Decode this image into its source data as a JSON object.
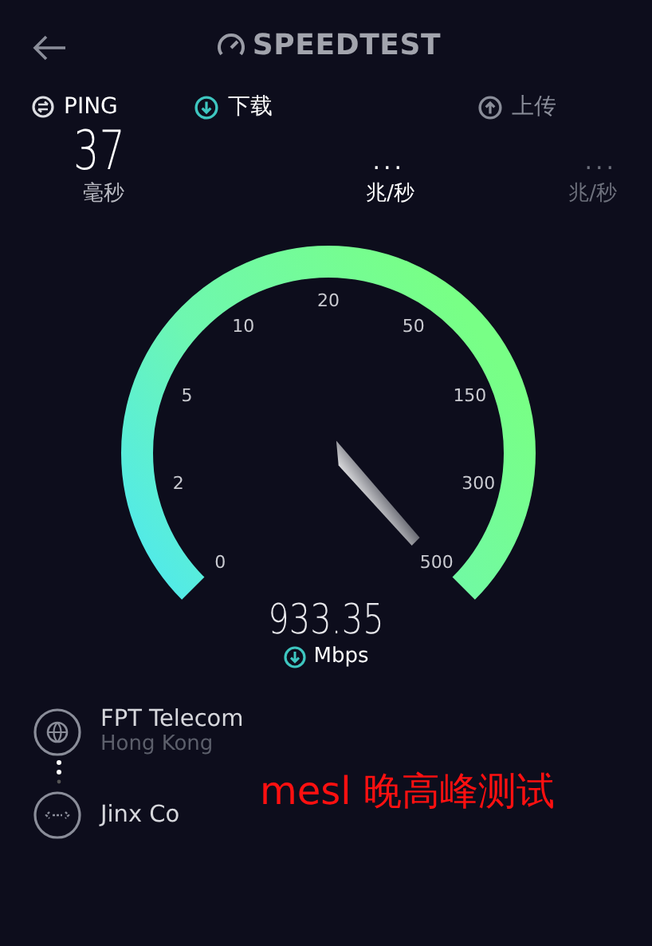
{
  "header": {
    "title": "SPEEDTEST"
  },
  "metrics": [
    {
      "kind": "ping",
      "label": "PING",
      "value": "37",
      "unit": "毫秒",
      "selected": false
    },
    {
      "kind": "download",
      "label": "下载",
      "value": "...",
      "unit": "兆/秒",
      "selected": true
    },
    {
      "kind": "upload",
      "label": "上传",
      "value": "...",
      "unit": "兆/秒",
      "selected": false
    }
  ],
  "gauge": {
    "scale": [
      "0",
      "2",
      "5",
      "10",
      "20",
      "50",
      "150",
      "300",
      "500"
    ],
    "reading": "933.35",
    "unit": "Mbps"
  },
  "servers": [
    {
      "kind": "provider",
      "name": "FPT Telecom",
      "location": "Hong Kong"
    },
    {
      "kind": "host",
      "name": "Jinx Co"
    }
  ],
  "annotation": "mesl 晚高峰测试"
}
